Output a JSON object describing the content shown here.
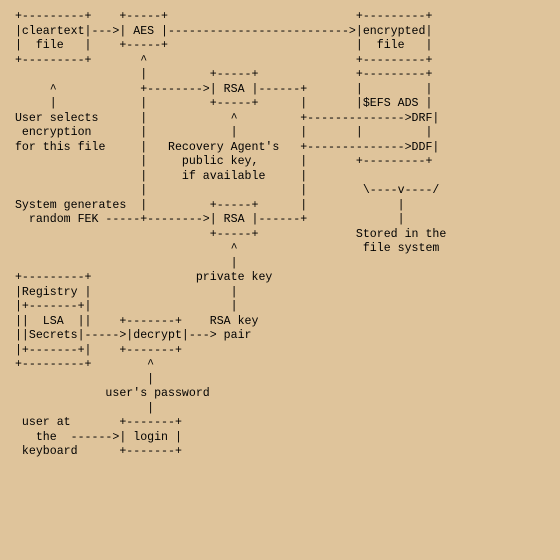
{
  "diagram": {
    "cleartext_box": "cleartext\n  file",
    "aes_box": "AES",
    "encrypted_box": "encrypted\n  file",
    "user_selects": "User selects\n encryption\nfor this file",
    "rsa_upper": "RSA",
    "rsa_lower": "RSA",
    "efs_ads": "$EFS ADS",
    "drf": "DRF",
    "ddf": "DDF",
    "recovery_agent": "Recovery Agent's\n  public key,\n  if available",
    "system_generates": "System generates\n  random FEK",
    "stored": "Stored in the\n file system",
    "private_key": "private key",
    "registry": "Registry",
    "lsa": "LSA",
    "secrets": "Secrets",
    "decrypt": "decrypt",
    "rsa_key_pair": "RSA key\npair",
    "users_password": "user's password",
    "user_at": "user at\n  the",
    "keyboard": "keyboard",
    "login": "login"
  },
  "ascii": " +---------+    +-----+                           +---------+\n |cleartext|--->| AES |-------------------------->|encrypted|\n |  file   |    +-----+                           |  file   |\n +---------+       ^                              +---------+\n                   |         +-----+              +---------+\n      ^            +-------->| RSA |------+       |         |\n      |            |         +-----+      |       |$EFS ADS |\n User selects      |            ^         +-------------->DRF|\n  encryption       |            |         |       |         |\n for this file     |   Recovery Agent's   +-------------->DDF|\n                   |     public key,      |       +---------+\n                   |     if available     |\n                   |                      |        \\----v----/\n System generates  |         +-----+      |             |\n   random FEK -----+-------->| RSA |------+             |\n                             +-----+              Stored in the\n                                ^                  file system\n                                |\n +---------+               private key\n |Registry |                    |\n |+-------+|                    |\n ||  LSA  ||    +-------+    RSA key\n ||Secrets|----->|decrypt|---> pair\n |+-------+|    +-------+\n +---------+        ^\n                    |\n              user's password\n                    |\n  user at       +-------+\n    the  ------>| login |\n  keyboard      +-------+"
}
